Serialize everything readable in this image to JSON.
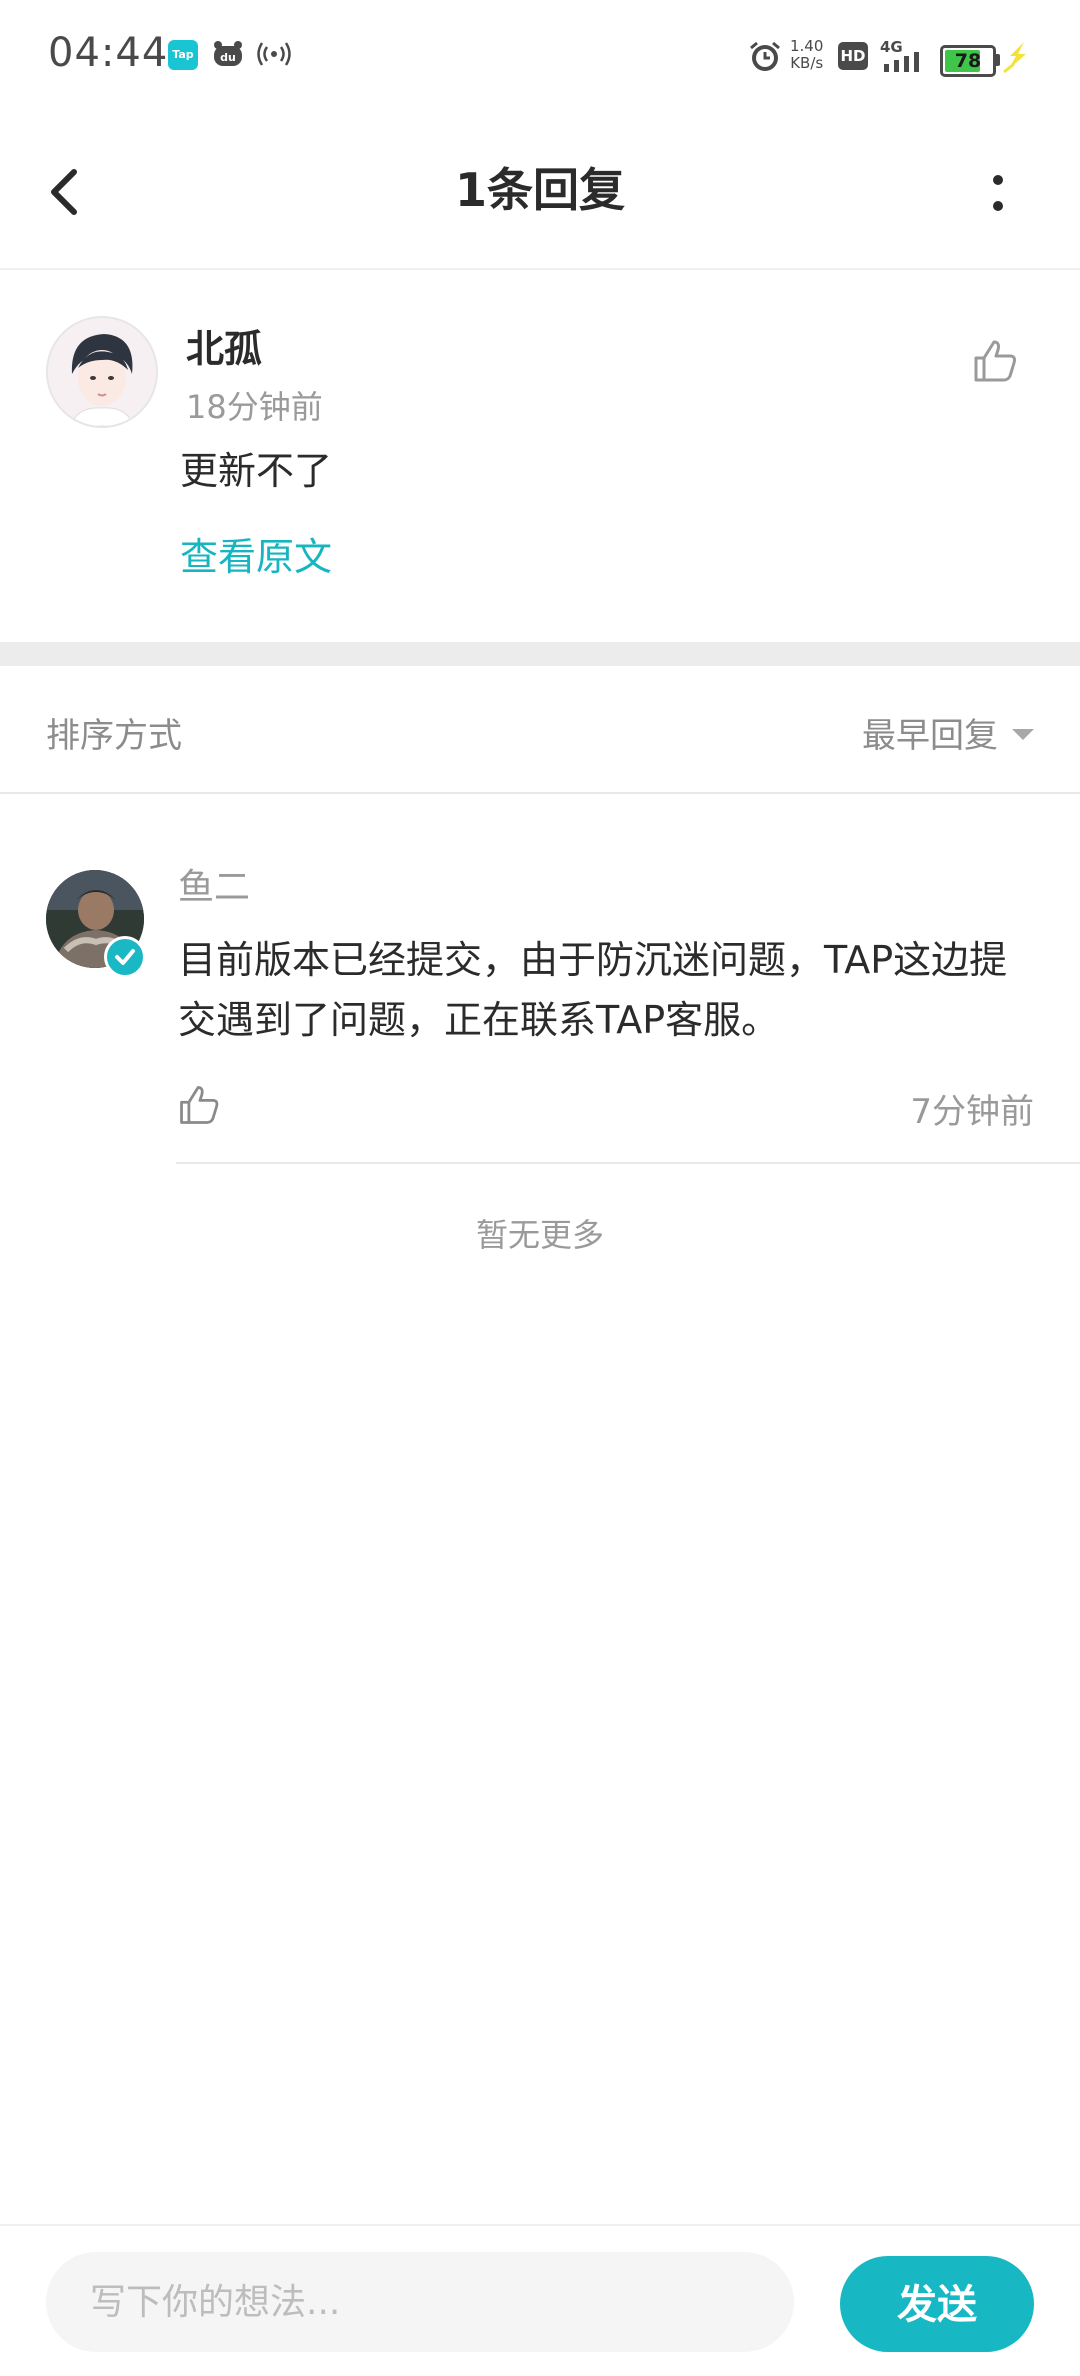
{
  "status_bar": {
    "time": "04:44",
    "tap_badge": "Tap",
    "speed_value": "1.40",
    "speed_unit": "KB/s",
    "hd_label": "HD",
    "network": "4G",
    "battery": "78",
    "battery_level_percent": 78,
    "icons": [
      "tap-app-icon",
      "du-app-icon",
      "radio-signal-icon",
      "alarm-icon",
      "hd-icon",
      "signal-icon",
      "battery-icon",
      "charging-bolt-icon"
    ]
  },
  "header": {
    "title": "1条回复",
    "icons": [
      "back-arrow-icon",
      "more-vertical-icon"
    ]
  },
  "post": {
    "author": "北孤",
    "time": "18分钟前",
    "content": "更新不了",
    "view_original": "查看原文",
    "icons": [
      "user-avatar",
      "thumbs-up-icon"
    ]
  },
  "sort": {
    "label": "排序方式",
    "selected": "最早回复"
  },
  "replies": [
    {
      "author": "鱼二",
      "content": "目前版本已经提交，由于防沉迷问题，TAP这边提交遇到了问题，正在联系TAP客服。",
      "time": "7分钟前"
    }
  ],
  "no_more": "暂无更多",
  "composer": {
    "placeholder": "写下你的想法...",
    "send_label": "发送"
  },
  "colors": {
    "accent": "#17b7c3",
    "text": "#2b2b2b",
    "muted": "#9a9a9a",
    "battery": "#3ec54a"
  }
}
